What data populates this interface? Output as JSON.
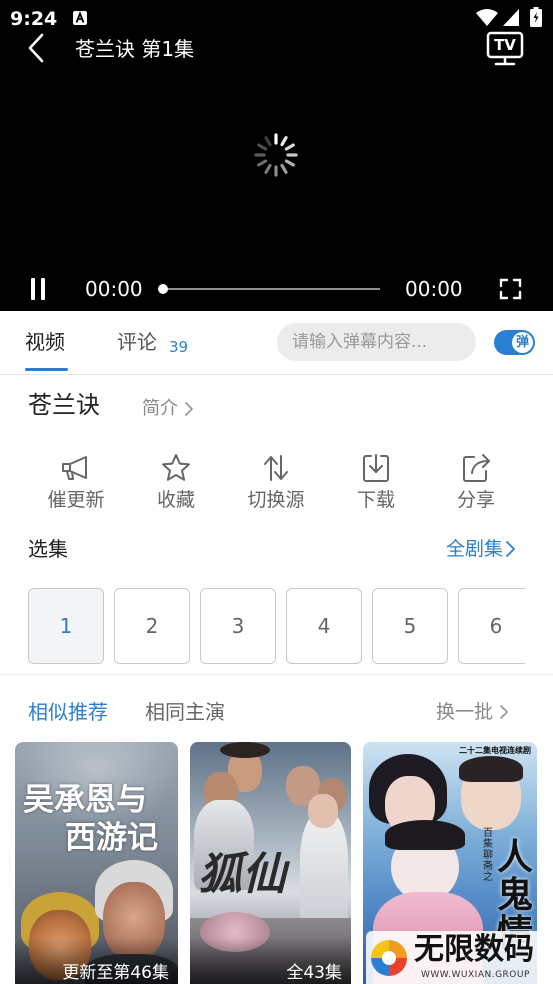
{
  "status_bar": {
    "time": "9:24",
    "icons": [
      "a-notification-icon",
      "wifi-icon",
      "signal-icon",
      "battery-icon"
    ]
  },
  "player": {
    "title": "苍兰诀 第1集",
    "tv_label": "TV",
    "state": "loading",
    "current_time": "00:00",
    "duration": "00:00",
    "progress": 0
  },
  "tabs": [
    {
      "label": "视频",
      "active": true
    },
    {
      "label": "评论",
      "badge": "39",
      "active": false
    }
  ],
  "danmaku": {
    "placeholder": "请输入弹幕内容...",
    "toggle_label": "弹",
    "enabled": true
  },
  "show": {
    "title": "苍兰诀",
    "intro_label": "简介"
  },
  "actions": [
    {
      "label": "催更新",
      "icon": "megaphone-icon"
    },
    {
      "label": "收藏",
      "icon": "star-icon"
    },
    {
      "label": "切换源",
      "icon": "switch-source-icon"
    },
    {
      "label": "下载",
      "icon": "download-icon"
    },
    {
      "label": "分享",
      "icon": "share-icon"
    }
  ],
  "episodes": {
    "heading": "选集",
    "all_label": "全剧集",
    "items": [
      "1",
      "2",
      "3",
      "4",
      "5",
      "6"
    ],
    "selected": "1"
  },
  "recommend": {
    "tabs": [
      {
        "label": "相似推荐",
        "active": true
      },
      {
        "label": "相同主演",
        "active": false
      }
    ],
    "refresh_label": "换一批",
    "items": [
      {
        "poster_title_lines": [
          "吴承恩与",
          "西游记"
        ],
        "caption": "更新至第46集"
      },
      {
        "poster_title": "狐仙",
        "caption": "全43集"
      },
      {
        "poster_title": "人鬼情",
        "poster_kicker": "百集聊斋之",
        "poster_banner": "二十二集电视连续剧"
      }
    ]
  },
  "watermark": {
    "name": "无限数码",
    "url": "WWW.WUXIAN.GROUP"
  },
  "colors": {
    "accent": "#2a7fd0",
    "player_bg": "#000000",
    "text_primary": "#222222",
    "text_secondary": "#666666",
    "input_bg": "#ececec"
  }
}
